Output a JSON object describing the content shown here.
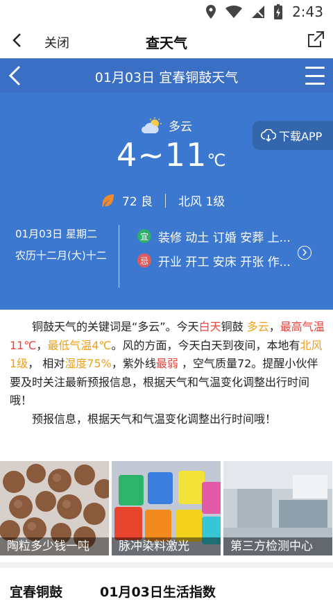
{
  "status_bar": {
    "time": "2:43",
    "icons": [
      "location-icon",
      "wifi-icon",
      "no-sim-icon",
      "battery-charging-icon"
    ]
  },
  "app_bar": {
    "close_label": "关闭",
    "title": "查天气"
  },
  "weather": {
    "nav_title": "01月03日 宜春铜鼓天气",
    "condition": "多云",
    "temperature": "4~11",
    "temp_unit": "℃",
    "download_label": "下载APP",
    "aqi": "72 良",
    "wind": "北风 1级",
    "date": "01月03日 星期二",
    "lunar": "农历十二月(大)十二",
    "yi_badge": "宜",
    "yi_text": "装修 动土 订婚 安葬 上...",
    "ji_badge": "忌",
    "ji_text": "开业 开工 安床 开张 作..."
  },
  "description": {
    "s1": "铜鼓天气的关键词是“多云”。今天",
    "s2": "白天",
    "s3": "铜鼓 ",
    "s4": "多云",
    "s5": "，",
    "s6": "最高气温11℃",
    "s7": "，",
    "s8": "最低气温4℃",
    "s9": "。风的方面，今天白天到夜间，本地有",
    "s10": "北风 1级",
    "s11": "， 相对",
    "s12": "湿度75%",
    "s13": "，紫外线",
    "s14": "最弱",
    "s15": " ，空气质量72。提醒小伙伴要及时关注最新预报信息，根据天气和气温变化调整出行时间哦！",
    "p2": "预报信息，根据天气和气温变化调整出行时间哦！"
  },
  "ads": [
    {
      "caption": "陶粒多少钱一吨"
    },
    {
      "caption": "脉冲染料激光"
    },
    {
      "caption": "第三方检测中心"
    }
  ],
  "bottom": {
    "location": "宜春铜鼓",
    "title": "01月03日生活指数"
  },
  "colors": {
    "header_blue": "#3c78cf",
    "highlight_red": "#e8433a",
    "highlight_orange": "#f0a018",
    "yi_green": "#2fae6e",
    "ji_red": "#e05a5a"
  }
}
